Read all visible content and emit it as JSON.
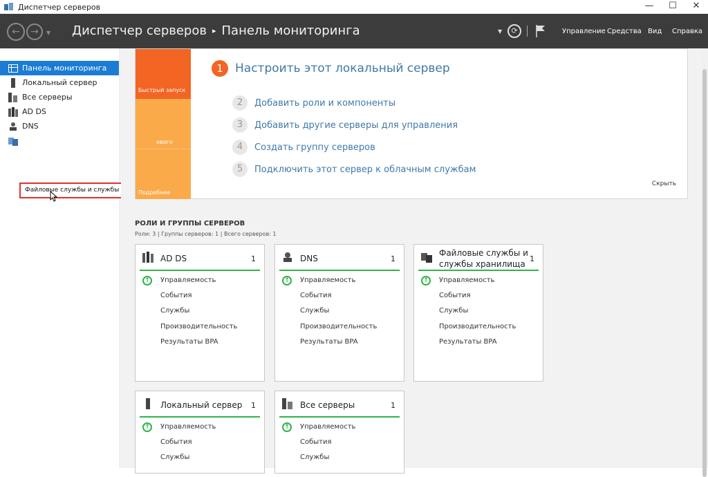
{
  "window": {
    "title": "Диспетчер серверов",
    "minimize": "—",
    "maximize": "☐",
    "close": "✕"
  },
  "header": {
    "title": "Диспетчер серверов",
    "separator": "▸",
    "page": "Панель мониторинга",
    "menu": {
      "manage": "Управление",
      "tools": "Средства",
      "view": "Вид",
      "help": "Справка"
    }
  },
  "sidebar": {
    "items": [
      {
        "label": "Панель мониторинга",
        "icon": "dashboard-icon"
      },
      {
        "label": "Локальный сервер",
        "icon": "server-icon"
      },
      {
        "label": "Все серверы",
        "icon": "servers-icon"
      },
      {
        "label": "AD DS",
        "icon": "ad-ds-icon"
      },
      {
        "label": "DNS",
        "icon": "dns-icon"
      },
      {
        "label": "Файловые службы и службы хранилища",
        "icon": "file-storage-icon"
      }
    ],
    "tooltip": "Файловые службы и службы хранилища"
  },
  "welcome": {
    "tiles": {
      "quick_start": "Быстрый запуск",
      "whats_new": "овогo",
      "learn_more": "Подробнее"
    },
    "step1": {
      "num": "1",
      "text": "Настроить этот локальный сервер"
    },
    "steps": [
      {
        "num": "2",
        "text": "Добавить роли и компоненты"
      },
      {
        "num": "3",
        "text": "Добавить другие серверы для управления"
      },
      {
        "num": "4",
        "text": "Создать группу серверов"
      },
      {
        "num": "5",
        "text": "Подключить этот сервер к облачным службам"
      }
    ],
    "hide": "Скрыть"
  },
  "roles": {
    "title": "РОЛИ И ГРУППЫ СЕРВЕРОВ",
    "summary": "Роли: 3 | Группы серверов: 1 | Всего серверов: 1",
    "rows": [
      "Управляемость",
      "События",
      "Службы",
      "Производительность",
      "Результаты BPA"
    ],
    "cards": [
      {
        "title": "AD DS",
        "count": "1",
        "icon": "ad-ds-icon"
      },
      {
        "title": "DNS",
        "count": "1",
        "icon": "dns-icon"
      },
      {
        "title_line1": "Файловые службы и",
        "title_line2": "службы хранилища",
        "count": "1",
        "icon": "file-storage-icon"
      },
      {
        "title": "Локальный сервер",
        "count": "1",
        "icon": "server-icon"
      },
      {
        "title": "Все серверы",
        "count": "1",
        "icon": "servers-icon"
      }
    ]
  },
  "colors": {
    "header_bg": "#3c3c3c",
    "active_item": "#1c7cd5",
    "quick_start_tile": "#f26522",
    "tile_light": "#fbaa4a",
    "link": "#3f79a8",
    "status_green": "#2fb34a",
    "tooltip_border": "#e0312c"
  }
}
